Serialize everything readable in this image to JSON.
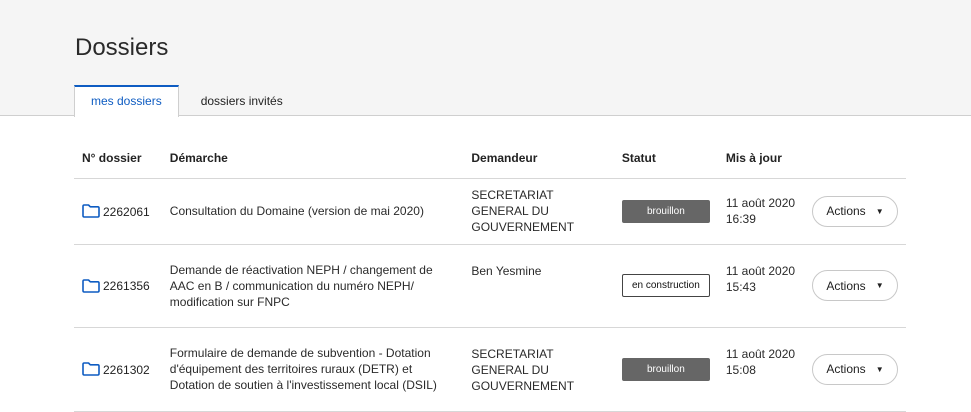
{
  "page": {
    "title": "Dossiers"
  },
  "tabs": [
    {
      "label": "mes dossiers",
      "active": true
    },
    {
      "label": "dossiers invités",
      "active": false
    }
  ],
  "table": {
    "headers": [
      "N° dossier",
      "Démarche",
      "Demandeur",
      "Statut",
      "Mis à jour"
    ],
    "rows": [
      {
        "number": "2262061",
        "demarche": "Consultation du Domaine (version de mai 2020)",
        "demandeur": "SECRETARIAT GENERAL DU GOUVERNEMENT",
        "statut": "brouillon",
        "date": "11 août 2020",
        "time": "16:39",
        "actions": "Actions"
      },
      {
        "number": "2261356",
        "demarche": "Demande de réactivation NEPH / changement de AAC en B / communication du numéro NEPH/ modification sur FNPC",
        "demandeur": "Ben Yesmine",
        "statut": "en construction",
        "date": "11 août 2020",
        "time": "15:43",
        "actions": "Actions"
      },
      {
        "number": "2261302",
        "demarche": "Formulaire de demande de subvention - Dotation d'équipement des territoires ruraux (DETR) et Dotation de soutien à l'investissement local (DSIL)",
        "demandeur": "SECRETARIAT GENERAL DU GOUVERNEMENT",
        "statut": "brouillon",
        "date": "11 août 2020",
        "time": "15:08",
        "actions": "Actions"
      }
    ]
  },
  "colors": {
    "accent": "#0e5cc2",
    "header_bg": "#f5f5f5",
    "badge_filled": "#666666"
  },
  "icons": {
    "folder": "folder-icon",
    "caret": "caret-down-icon"
  }
}
